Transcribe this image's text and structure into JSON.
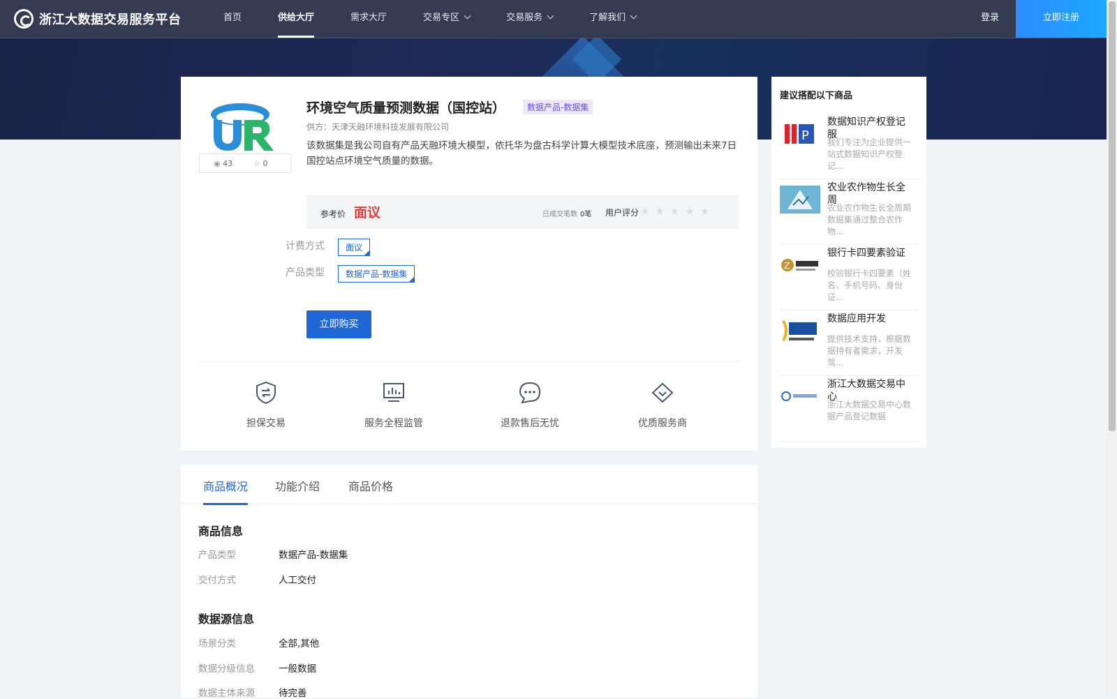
{
  "nav": {
    "logo_text": "浙江大数据交易服务平台",
    "items": [
      {
        "label": "首页"
      },
      {
        "label": "供给大厅"
      },
      {
        "label": "需求大厅"
      },
      {
        "label": "交易专区"
      },
      {
        "label": "交易服务"
      },
      {
        "label": "了解我们"
      }
    ],
    "active_index": 1,
    "login": "登录",
    "register": "立即注册"
  },
  "product": {
    "title": "环境空气质量预测数据（国控站）",
    "tag": "数据产品-数据集",
    "supplier": "供方：天津天融环境科技发展有限公司",
    "description": "该数据集是我公司自有产品天融环境大模型，依托华为盘古科学计算大模型技术底座，预测输出未来7日国控站点环境空气质量的数据。",
    "views": "43",
    "favorites": "0",
    "price_label": "参考价",
    "price_value": "面议",
    "deals_label": "已成交笔数",
    "deals_value": "0笔",
    "rating_label": "用户评分",
    "rating_stars": "★★★★★",
    "billing_label": "计费方式",
    "billing_value": "面议",
    "type_label": "产品类型",
    "type_value": "数据产品-数据集",
    "buy_button": "立即购买"
  },
  "services": [
    {
      "label": "担保交易",
      "icon": "shield-exchange-icon"
    },
    {
      "label": "服务全程监管",
      "icon": "monitor-chart-icon"
    },
    {
      "label": "退款售后无忧",
      "icon": "chat-bubble-icon"
    },
    {
      "label": "优质服务商",
      "icon": "diamond-icon"
    }
  ],
  "tabs": [
    {
      "label": "商品概况"
    },
    {
      "label": "功能介绍"
    },
    {
      "label": "商品价格"
    }
  ],
  "info": {
    "section1_title": "商品信息",
    "rows1": [
      {
        "k": "产品类型",
        "v": "数据产品-数据集"
      },
      {
        "k": "交付方式",
        "v": "人工交付"
      }
    ],
    "section2_title": "数据源信息",
    "rows2": [
      {
        "k": "场景分类",
        "v": "全部,其他"
      },
      {
        "k": "数据分级信息",
        "v": "一般数据"
      },
      {
        "k": "数据主体来源",
        "v": "待完善"
      }
    ]
  },
  "sidebar": {
    "title": "建议搭配以下商品",
    "items": [
      {
        "name": "数据知识产权登记服",
        "desc": "我们专注为企业提供一站式数据知识产权登记..."
      },
      {
        "name": "农业农作物生长全周",
        "desc": "农业农作物生长全周期数据集通过整合农作物..."
      },
      {
        "name": "银行卡四要素验证",
        "desc": "校验银行卡四要素（姓名、手机号码、身份证..."
      },
      {
        "name": "数据应用开发",
        "desc": "提供技术支持，根据数据持有者需求，开发驾..."
      },
      {
        "name": "浙江大数据交易中心",
        "desc": "浙江大数据交易中心数据产品登记数据"
      }
    ]
  },
  "colors": {
    "accent": "#1f66d6",
    "price": "#e23b3b",
    "nav_bg": "#333a52"
  }
}
